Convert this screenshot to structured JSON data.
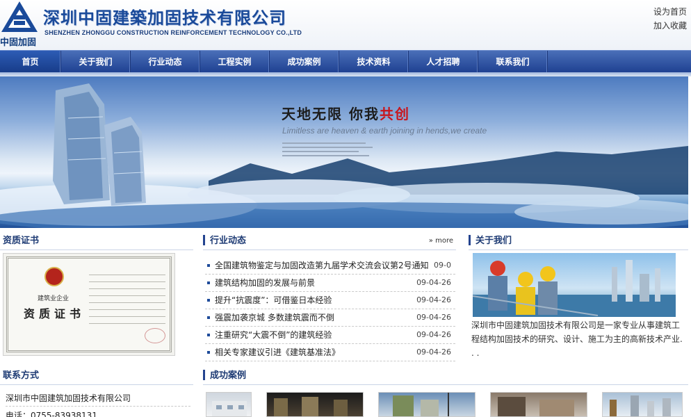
{
  "header": {
    "logo_cn": "中固加固",
    "company_cn": "深圳中固建築加固技术有限公司",
    "company_en": "SHENZHEN ZHONGGU CONSTRUCTION REINFORCEMENT TECHNOLOGY CO.,LTD",
    "set_home": "设为首页",
    "add_favorite": "加入收藏"
  },
  "nav": {
    "items": [
      {
        "label": "首页"
      },
      {
        "label": "关于我们"
      },
      {
        "label": "行业动态"
      },
      {
        "label": "工程实例"
      },
      {
        "label": "成功案例"
      },
      {
        "label": "技术资料"
      },
      {
        "label": "人才招聘"
      },
      {
        "label": "联系我们"
      }
    ]
  },
  "banner": {
    "slogan_part1": "天地无限  你我",
    "slogan_part2": "共创",
    "slogan_en": "Limitless are heaven & earth joining in hends,we create"
  },
  "certificate": {
    "title": "资质证书",
    "cert_small": "建筑业企业",
    "cert_big": "资质证书"
  },
  "news": {
    "title": "行业动态",
    "more": "» more",
    "items": [
      {
        "title": "全国建筑物鉴定与加固改造第九届学术交流会议第2号通知",
        "date": "09-0"
      },
      {
        "title": "建筑结构加固的发展与前景",
        "date": "09-04-26"
      },
      {
        "title": "提升“抗震度”：可借鉴日本经验",
        "date": "09-04-26"
      },
      {
        "title": "强震加袭京城  多数建筑震而不倒",
        "date": "09-04-26"
      },
      {
        "title": "注重研究“大震不倒”的建筑经验",
        "date": "09-04-26"
      },
      {
        "title": "相关专家建议引进《建筑基准法》",
        "date": "09-04-26"
      }
    ]
  },
  "about": {
    "title": "关于我们",
    "text": "深圳市中固建筑加固技术有限公司是一家专业从事建筑工程结构加固技术的研究、设计、施工为主的高新技术产业. . ."
  },
  "contact": {
    "title": "联系方式",
    "company": "深圳市中固建筑加固技术有限公司",
    "phone": "电话：0755-83938131"
  },
  "cases": {
    "title": "成功案例"
  },
  "colors": {
    "nav_bg": "#2a4c9c",
    "title_blue": "#1e3b74",
    "slogan_red": "#c8161d"
  }
}
